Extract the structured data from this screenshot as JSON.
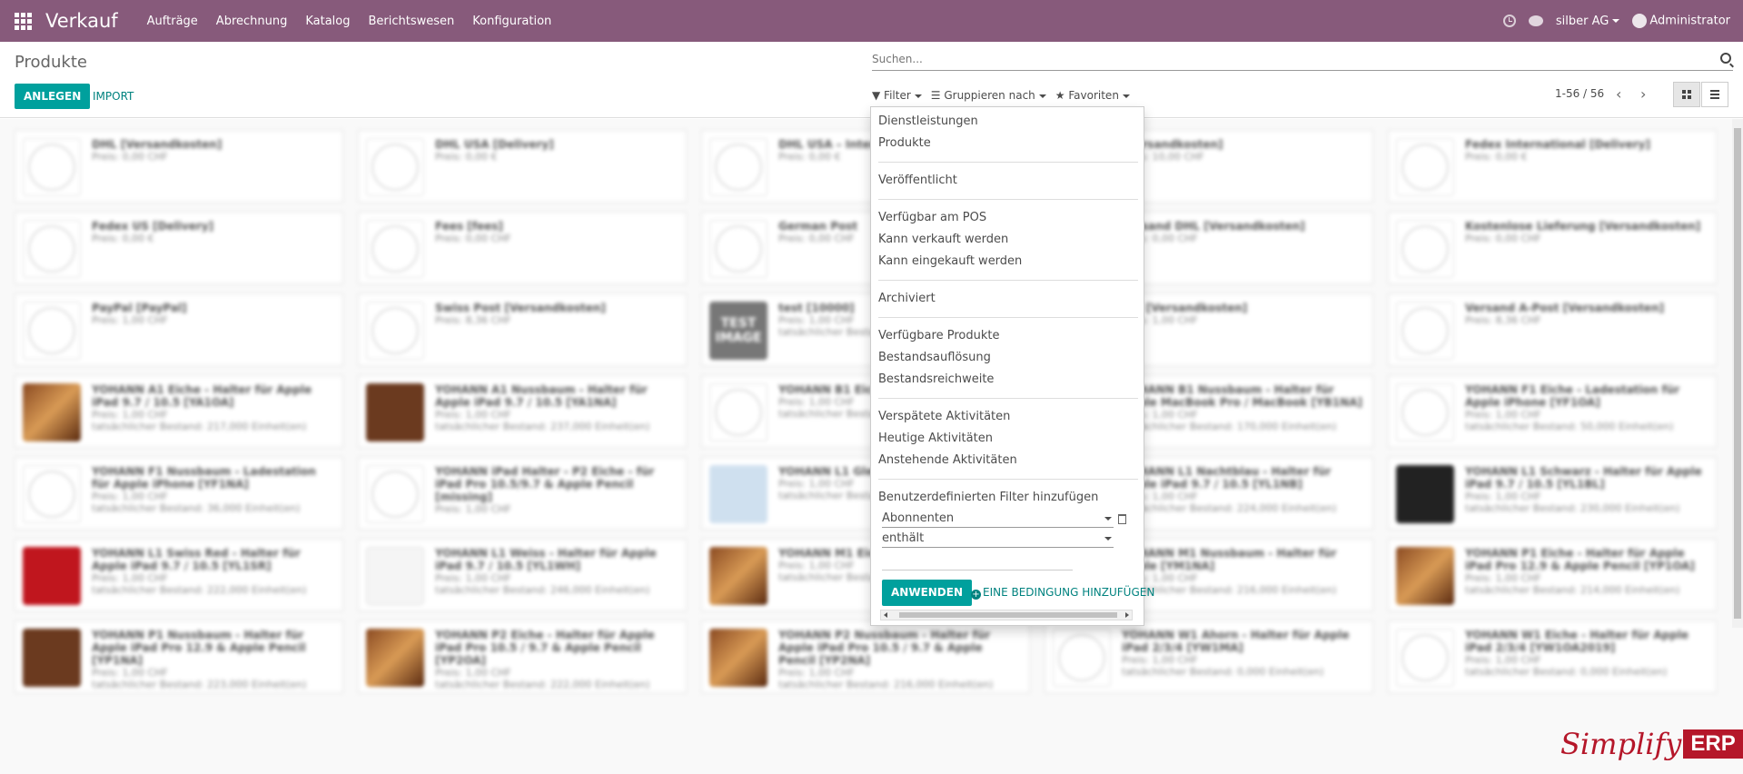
{
  "navbar": {
    "brand": "Verkauf",
    "menu": [
      "Aufträge",
      "Abrechnung",
      "Katalog",
      "Berichtswesen",
      "Konfiguration"
    ],
    "company": "silber AG",
    "user": "Administrator",
    "color": "#875a7b"
  },
  "control_panel": {
    "breadcrumb": "Produkte",
    "create_label": "ANLEGEN",
    "import_label": "IMPORT",
    "search_placeholder": "Suchen...",
    "filter_label": "Filter",
    "groupby_label": "Gruppieren nach",
    "favorites_label": "Favoriten",
    "pager": "1-56 / 56",
    "accent": "#00a09d"
  },
  "filter_menu": {
    "items": [
      "Dienstleistungen",
      "Produkte",
      "Veröffentlicht",
      "Verfügbar am POS",
      "Kann verkauft werden",
      "Kann eingekauft werden",
      "Archiviert",
      "Verfügbare Produkte",
      "Bestandsauflösung",
      "Bestandsreichweite",
      "Verspätete Aktivitäten",
      "Heutige Aktivitäten",
      "Anstehende Aktivitäten",
      "Benutzerdefinierten Filter hinzufügen"
    ],
    "field_select": "Abonnenten",
    "operator_select": "enthält",
    "apply_label": "ANWENDEN",
    "add_condition_label": "EINE BEDINGUNG HINZUFÜGEN"
  },
  "products": [
    {
      "name": "DHL [Versandkosten]",
      "price": "Preis: 0,00 CHF",
      "stock": ""
    },
    {
      "name": "DHL USA [Delivery]",
      "price": "Preis: 0,00 €",
      "stock": ""
    },
    {
      "name": "DHL USA – Internet",
      "price": "Preis: 0,00 €",
      "stock": ""
    },
    {
      "name": "[Versandkosten]",
      "price": "Preis: 10,00 CHF",
      "stock": ""
    },
    {
      "name": "Fedex International [Delivery]",
      "price": "Preis: 0,00 €",
      "stock": ""
    },
    {
      "name": "Fedex US [Delivery]",
      "price": "Preis: 0,00 €",
      "stock": ""
    },
    {
      "name": "Fees [fees]",
      "price": "Preis: 0,00 CHF",
      "stock": ""
    },
    {
      "name": "German Post",
      "price": "Preis: 0,00 CHF",
      "stock": ""
    },
    {
      "name": "versand DHL [Versandkosten]",
      "price": "Preis: 0,00 CHF",
      "stock": ""
    },
    {
      "name": "Kostenlose Lieferung [Versandkosten]",
      "price": "Preis: 0,00 CHF",
      "stock": ""
    },
    {
      "name": "PayPal [PayPal]",
      "price": "Preis: 1,00 CHF",
      "stock": ""
    },
    {
      "name": "Swiss Post [Versandkosten]",
      "price": "Preis: 8,36 CHF",
      "stock": ""
    },
    {
      "name": "test [10000]",
      "price": "Preis: 1,00 CHF",
      "stock": "tatsächlicher Bestand"
    },
    {
      "name": "ard [Versandkosten]",
      "price": "Preis: 1,00 CHF",
      "stock": ""
    },
    {
      "name": "Versand A-Post [Versandkosten]",
      "price": "Preis: 8,36 CHF",
      "stock": ""
    },
    {
      "name": "YOHANN A1 Eiche - Halter für Apple iPad 9.7 / 10.5 [YA1OA]",
      "price": "Preis: 1,00 CHF",
      "stock": "tatsächlicher Bestand: 217,000 Einheit(en)"
    },
    {
      "name": "YOHANN A1 Nussbaum - Halter für Apple iPad 9.7 / 10.5 [YA1NA]",
      "price": "Preis: 1,00 CHF",
      "stock": "tatsächlicher Bestand: 237,000 Einheit(en)"
    },
    {
      "name": "YOHANN B1 Eiche",
      "price": "Preis: 1,00 CHF",
      "stock": "tatsächlicher Bestand"
    },
    {
      "name": "YOHANN B1 Nussbaum - Halter für Apple MacBook Pro / MacBook [YB1NA]",
      "price": "Preis: 1,00 CHF",
      "stock": "tatsächlicher Bestand: 170,000 Einheit(en)"
    },
    {
      "name": "YOHANN F1 Eiche - Ladestation für Apple iPhone [YF1OA]",
      "price": "Preis: 1,00 CHF",
      "stock": "tatsächlicher Bestand: 50,000 Einheit(en)"
    },
    {
      "name": "YOHANN F1 Nussbaum - Ladestation für Apple iPhone [YF1NA]",
      "price": "Preis: 1,00 CHF",
      "stock": "tatsächlicher Bestand: 36,000 Einheit(en)"
    },
    {
      "name": "YOHANN iPad Halter - P2 Eiche - für iPad Pro 10.5/9.7 & Apple Pencil [missing]",
      "price": "Preis: 1,00 CHF",
      "stock": ""
    },
    {
      "name": "YOHANN L1 Gletscher - iPad 9.7 / 10.5",
      "price": "Preis: 1,00 CHF",
      "stock": "tatsächlicher Bestand"
    },
    {
      "name": "YOHANN L1 Nachtblau - Halter für Apple iPad 9.7 / 10.5 [YL1NB]",
      "price": "Preis: 1,00 CHF",
      "stock": "tatsächlicher Bestand: 224,000 Einheit(en)"
    },
    {
      "name": "YOHANN L1 Schwarz - Halter für Apple iPad 9.7 / 10.5 [YL1BL]",
      "price": "Preis: 1,00 CHF",
      "stock": "tatsächlicher Bestand: 230,000 Einheit(en)"
    },
    {
      "name": "YOHANN L1 Swiss Red - Halter für Apple iPad 9.7 / 10.5 [YL1SR]",
      "price": "Preis: 1,00 CHF",
      "stock": "tatsächlicher Bestand: 222,000 Einheit(en)"
    },
    {
      "name": "YOHANN L1 Weiss - Halter für Apple iPad 9.7 / 10.5 [YL1WH]",
      "price": "Preis: 1,00 CHF",
      "stock": "tatsächlicher Bestand: 246,000 Einheit(en)"
    },
    {
      "name": "YOHANN M1 Eiche [YM1OA]",
      "price": "Preis: 1,00 CHF",
      "stock": "tatsächlicher Bestand"
    },
    {
      "name": "YOHANN M1 Nussbaum - Halter für Apple [YM1NA]",
      "price": "Preis: 1,00 CHF",
      "stock": "tatsächlicher Bestand: 216,000 Einheit(en)"
    },
    {
      "name": "YOHANN P1 Eiche - Halter für Apple iPad Pro 12.9 & Apple Pencil [YP1OA]",
      "price": "Preis: 1,00 CHF",
      "stock": "tatsächlicher Bestand: 214,000 Einheit(en)"
    },
    {
      "name": "YOHANN P1 Nussbaum - Halter für Apple iPad Pro 12.9 & Apple Pencil [YP1NA]",
      "price": "Preis: 1,00 CHF",
      "stock": "tatsächlicher Bestand: 223,000 Einheit(en)"
    },
    {
      "name": "YOHANN P2 Eiche - Halter für Apple iPad Pro 10.5 / 9.7 & Apple Pencil [YP2OA]",
      "price": "Preis: 1,00 CHF",
      "stock": "tatsächlicher Bestand: 222,000 Einheit(en)"
    },
    {
      "name": "YOHANN P2 Nussbaum - Halter für Apple iPad Pro 10.5 / 9.7 & Apple Pencil [YP2NA]",
      "price": "Preis: 1,00 CHF",
      "stock": "tatsächlicher Bestand: 216,000 Einheit(en)"
    },
    {
      "name": "YOHANN W1 Ahorn - Halter für Apple iPad 2/3/4 [YW1MA]",
      "price": "Preis: 1,00 CHF",
      "stock": "tatsächlicher Bestand: 0,000 Einheit(en)"
    },
    {
      "name": "YOHANN W1 Eiche - Halter für Apple iPad 2/3/4 [YW1OA2019]",
      "price": "Preis: 1,00 CHF",
      "stock": "tatsächlicher Bestand: 0,000 Einheit(en)"
    }
  ],
  "watermark": {
    "text": "Simplify",
    "badge": "ERP"
  }
}
